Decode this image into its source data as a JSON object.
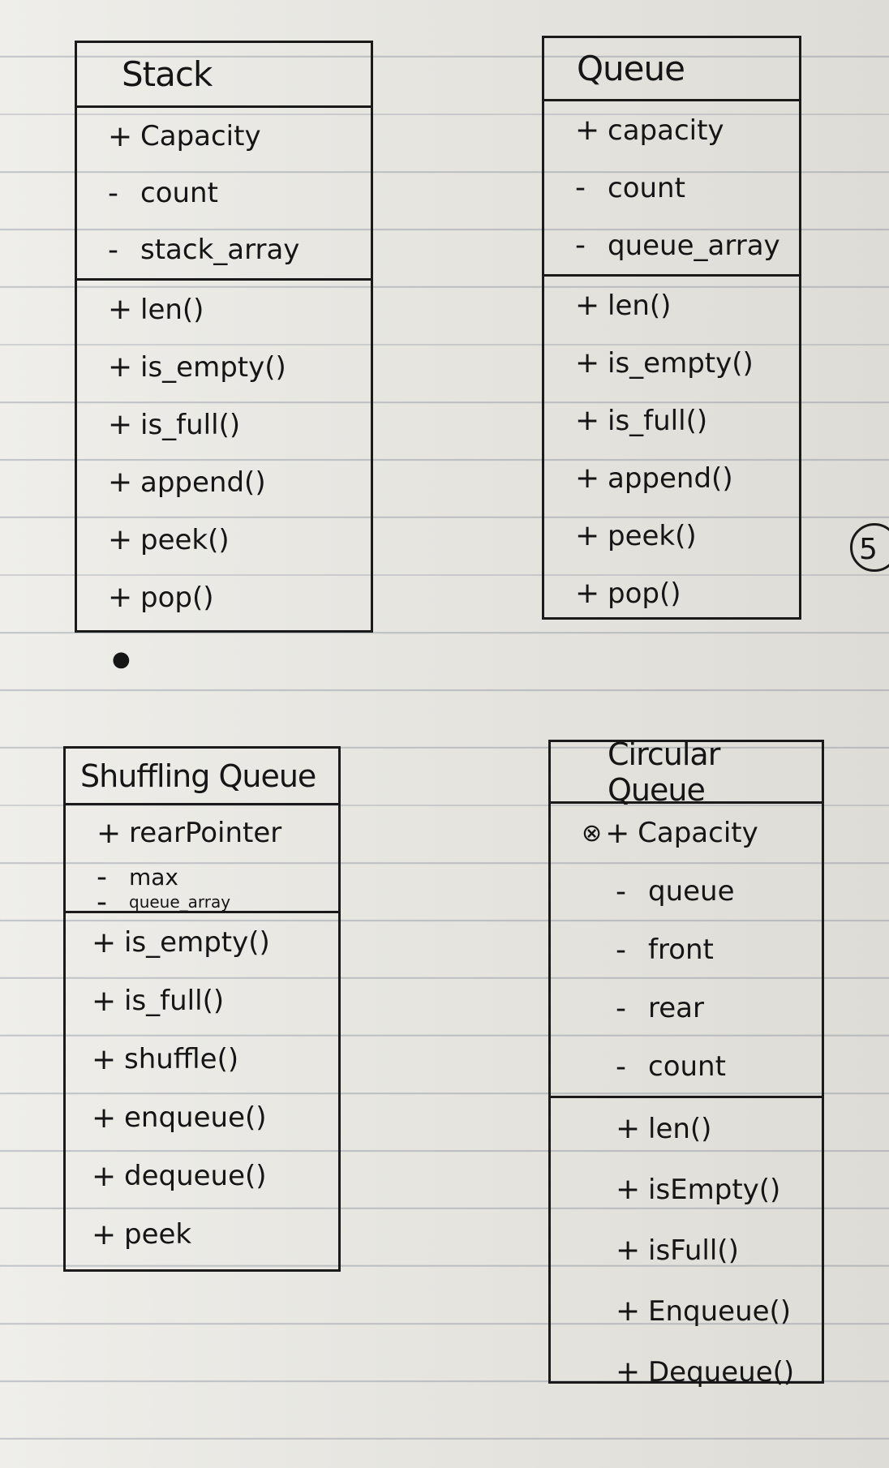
{
  "classes": [
    {
      "name": "Stack",
      "attributes": [
        {
          "vis": "+",
          "name": "Capacity"
        },
        {
          "vis": "-",
          "name": "count"
        },
        {
          "vis": "-",
          "name": "stack_array"
        }
      ],
      "methods": [
        {
          "vis": "+",
          "name": "len()"
        },
        {
          "vis": "+",
          "name": "is_empty()"
        },
        {
          "vis": "+",
          "name": "is_full()"
        },
        {
          "vis": "+",
          "name": "append()"
        },
        {
          "vis": "+",
          "name": "peek()"
        },
        {
          "vis": "+",
          "name": "pop()"
        }
      ]
    },
    {
      "name": "Queue",
      "attributes": [
        {
          "vis": "+",
          "name": "capacity"
        },
        {
          "vis": "-",
          "name": "count"
        },
        {
          "vis": "-",
          "name": "queue_array"
        }
      ],
      "methods": [
        {
          "vis": "+",
          "name": "len()"
        },
        {
          "vis": "+",
          "name": "is_empty()"
        },
        {
          "vis": "+",
          "name": "is_full()"
        },
        {
          "vis": "+",
          "name": "append()"
        },
        {
          "vis": "+",
          "name": "peek()"
        },
        {
          "vis": "+",
          "name": "pop()"
        }
      ]
    },
    {
      "name": "Shuffling Queue",
      "attributes": [
        {
          "vis": "+",
          "name": "rearPointer"
        },
        {
          "vis": "-",
          "name": "max"
        },
        {
          "vis": "-",
          "name": "queue_array"
        }
      ],
      "methods": [
        {
          "vis": "+",
          "name": "is_empty()"
        },
        {
          "vis": "+",
          "name": "is_full()"
        },
        {
          "vis": "+",
          "name": "shuffle()"
        },
        {
          "vis": "+",
          "name": "enqueue()"
        },
        {
          "vis": "+",
          "name": "dequeue()"
        },
        {
          "vis": "+",
          "name": "peek"
        }
      ]
    },
    {
      "name": "Circular Queue",
      "attributes": [
        {
          "vis": "+",
          "name": "Capacity"
        },
        {
          "vis": "-",
          "name": "queue"
        },
        {
          "vis": "-",
          "name": "front"
        },
        {
          "vis": "-",
          "name": "rear"
        },
        {
          "vis": "-",
          "name": "count"
        }
      ],
      "methods": [
        {
          "vis": "+",
          "name": "len()"
        },
        {
          "vis": "+",
          "name": "isEmpty()"
        },
        {
          "vis": "+",
          "name": "isFull()"
        },
        {
          "vis": "+",
          "name": "Enqueue()"
        },
        {
          "vis": "+",
          "name": "Dequeue()"
        }
      ]
    }
  ],
  "page_mark": "5",
  "colors": {
    "ink": "#151515",
    "paper": "#e9e8e4",
    "rule_line": "#6e788c"
  }
}
